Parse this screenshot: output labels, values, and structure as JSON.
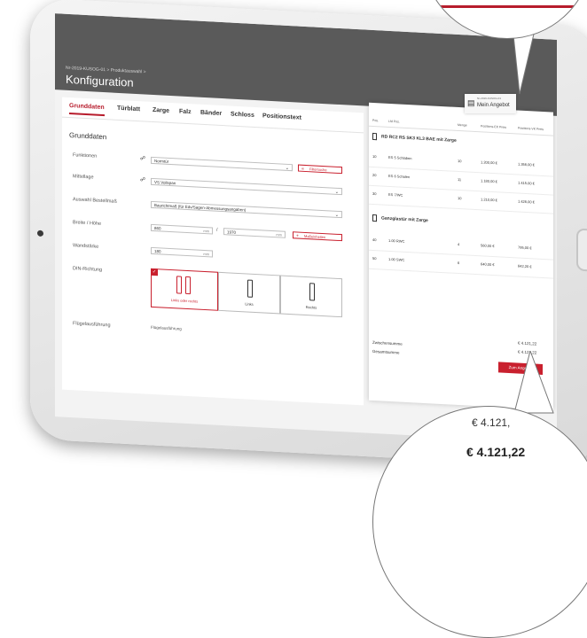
{
  "header": {
    "breadcrumb": "Nr-2019-KUSOG-01  >  Produktauswahl  >",
    "title": "Konfiguration"
  },
  "tabs": [
    "Grunddaten",
    "Türblatt",
    "Zarge",
    "Falz",
    "Bänder",
    "Schloss",
    "Positionstext"
  ],
  "form": {
    "section": "Grunddaten",
    "funktionen": {
      "label": "Funktionen",
      "value": "Normtür",
      "button": "Filtersuche"
    },
    "mittellage": {
      "label": "Mittellage",
      "value": "VS Vollspan"
    },
    "bestellmass": {
      "label": "Auswahl Bestellmaß",
      "value": "Baurichtmaß (für Edv/Sagen-Abmessungsangaben)"
    },
    "breite_hoehe": {
      "label": "Breite / Höhe",
      "width": "860",
      "width_unit": "mm",
      "separator": "/",
      "height": "1970",
      "height_unit": "mm",
      "button": "Maßeinheiten"
    },
    "wandstaerke": {
      "label": "Wandstärke",
      "value": "180",
      "unit": "mm"
    },
    "din": {
      "label": "DIN-Richtung",
      "options": [
        "Links oder rechts",
        "Links",
        "Rechts"
      ],
      "selected": "Links oder rechts"
    },
    "fluegel": {
      "label": "Flügelausführung",
      "value": "Flügelausführung"
    }
  },
  "offer_badge": {
    "subtitle": "Nr-2019-KUSOG-01",
    "title": "Mein Angebot"
  },
  "offer": {
    "columns": [
      "Pos.",
      "Lfd Pos.",
      "Menge",
      "Positions-EK Preis",
      "Positions-VK Preis"
    ],
    "groups": [
      {
        "name": "RD RC2 RS SK3 KL3 BAE mit Zarge",
        "rows": [
          {
            "pos": "10",
            "name": "ES 5 Schlaben",
            "qty": "10",
            "ek": "1.200,00 €",
            "vk": "1.356,00 €"
          },
          {
            "pos": "20",
            "name": "ES 6 Schalen",
            "qty": "11",
            "ek": "1.180,00 €",
            "vk": "1.415,00 €"
          },
          {
            "pos": "30",
            "name": "ES 7/WC",
            "qty": "10",
            "ek": "1.210,00 €",
            "vk": "1.426,00 €"
          }
        ]
      },
      {
        "name": "Ganzglastür mit Zarge",
        "rows": [
          {
            "pos": "40",
            "name": "1.00 RWC",
            "qty": "4",
            "ek": "560,00 €",
            "vk": "795,00 €"
          },
          {
            "pos": "50",
            "name": "1.00 SWC",
            "qty": "6",
            "ek": "640,00 €",
            "vk": "842,20 €"
          }
        ]
      }
    ],
    "subtotal_label": "Zwischensumme",
    "subtotal_value": "€ 4.121,22",
    "total_label": "Gesamtsumme",
    "total_value": "€ 4.121,22",
    "button": "Zum Angebot"
  },
  "magnifier": {
    "line1": "€ 4.121,",
    "line2": "€ 4.121,22"
  },
  "colors": {
    "accent": "#c9202e",
    "topbar": "#5a5a5a"
  }
}
